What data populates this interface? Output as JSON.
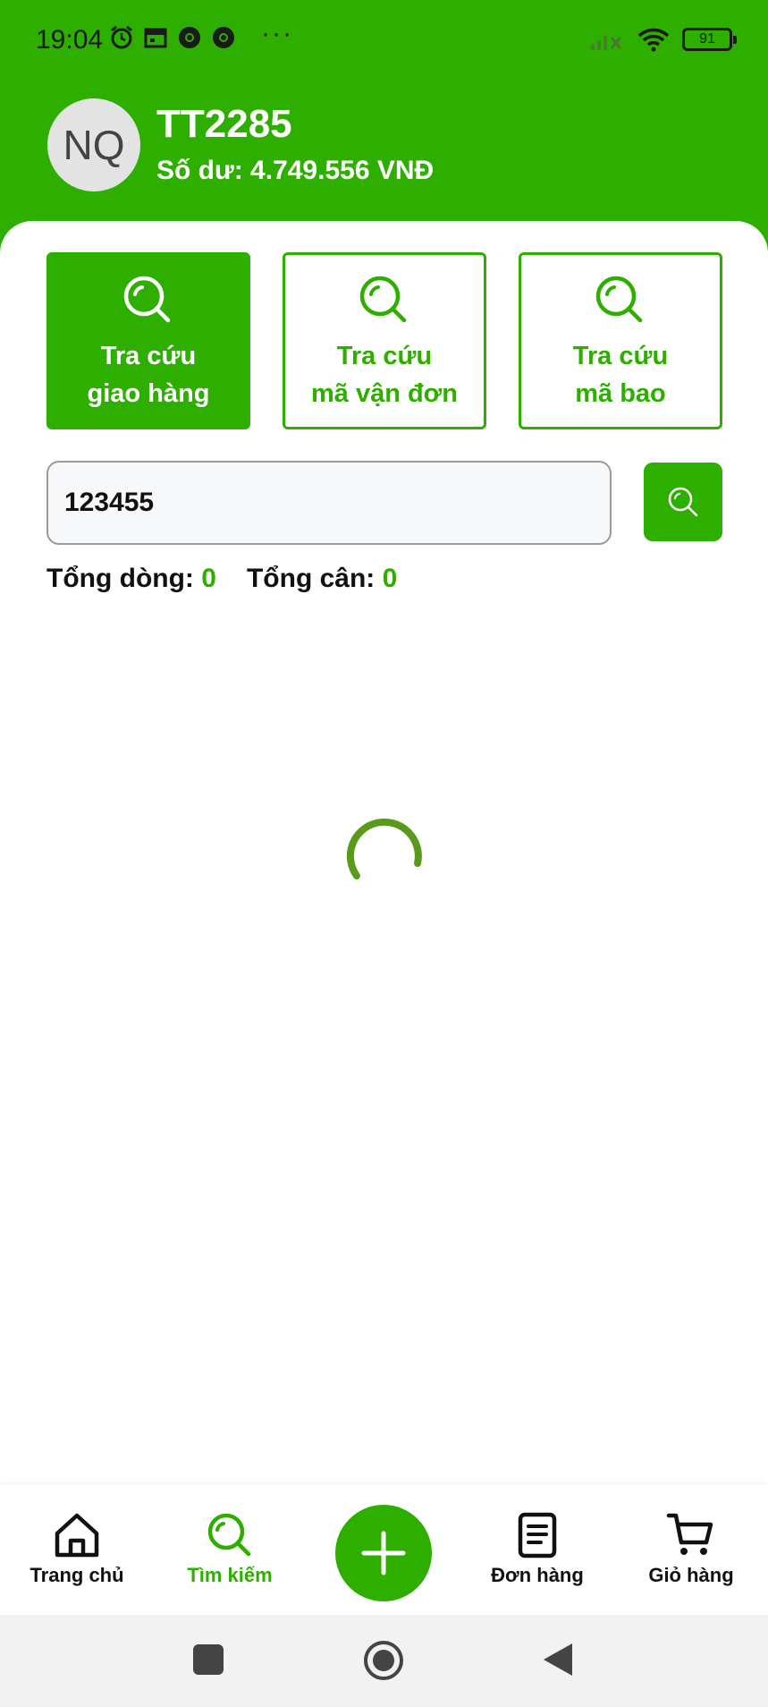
{
  "status_bar": {
    "time": "19:04",
    "more": "···",
    "battery": "91"
  },
  "header": {
    "avatar_initials": "NQ",
    "username": "TT2285",
    "balance": "Số dư: 4.749.556 VNĐ"
  },
  "tabs": [
    {
      "label": "Tra cứu\ngiao hàng",
      "active": true
    },
    {
      "label": "Tra cứu\nmã vận đơn",
      "active": false
    },
    {
      "label": "Tra cứu\nmã bao",
      "active": false
    }
  ],
  "search": {
    "value": "123455",
    "placeholder": ""
  },
  "totals": {
    "lines_label": "Tổng dòng:",
    "lines_value": "0",
    "weight_label": "Tổng cân:",
    "weight_value": "0"
  },
  "bottom_nav": {
    "home": "Trang chủ",
    "search": "Tìm kiếm",
    "orders": "Đơn hàng",
    "cart": "Giỏ hàng"
  },
  "colors": {
    "brand_green": "#2eaf00"
  }
}
